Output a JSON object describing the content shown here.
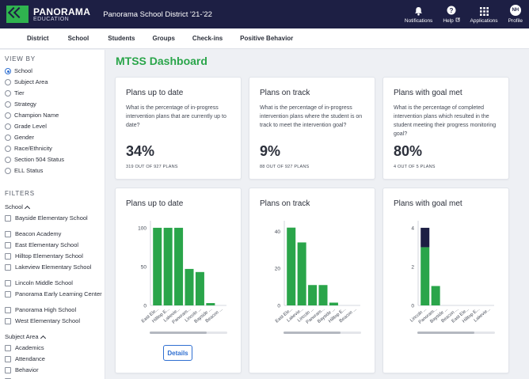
{
  "header": {
    "logo_line1": "PANORAMA",
    "logo_line2": "EDUCATION",
    "district": "Panorama School District '21-'22",
    "actions": {
      "notifications": "Notifications",
      "help": "Help",
      "applications": "Applications",
      "profile": "Profile"
    },
    "avatar_initials": "NH"
  },
  "nav": {
    "tabs": [
      "District",
      "School",
      "Students",
      "Groups",
      "Check-ins",
      "Positive Behavior"
    ]
  },
  "sidebar": {
    "view_by_title": "VIEW BY",
    "view_by": [
      "School",
      "Subject Area",
      "Tier",
      "Strategy",
      "Champion Name",
      "Grade Level",
      "Gender",
      "Race/Ethnicity",
      "Section 504 Status",
      "ELL Status"
    ],
    "view_by_selected": 0,
    "filters_title": "FILTERS",
    "school_filter_title": "School",
    "schools": [
      "Bayside Elementary School",
      "Beacon Academy",
      "East Elementary School",
      "Hilltop Elementary School",
      "Lakeview Elementary School",
      "Lincoln Middle School",
      "Panorama Early Learning Center",
      "Panorama High School",
      "West Elementary School"
    ],
    "subject_filter_title": "Subject Area",
    "subjects": [
      "Academics",
      "Attendance",
      "Behavior"
    ]
  },
  "main": {
    "title": "MTSS Dashboard",
    "stat_cards": [
      {
        "title": "Plans up to date",
        "description": "What is the percentage of in-progress intervention plans that are currently up to date?",
        "value": "34%",
        "sub": "319 OUT OF 927 PLANS"
      },
      {
        "title": "Plans on track",
        "description": "What is the percentage of in-progress intervention plans where the student is on track to meet the intervention goal?",
        "value": "9%",
        "sub": "88 OUT OF 927 PLANS"
      },
      {
        "title": "Plans with goal met",
        "description": "What is the percentage of completed intervention plans which resulted in the student meeting their progress monitoring goal?",
        "value": "80%",
        "sub": "4 OUT OF 5 PLANS"
      }
    ],
    "details_label": "Details"
  },
  "chart_data": [
    {
      "type": "bar",
      "title": "Plans up to date",
      "categories": [
        "East Ele...",
        "Hilltop E...",
        "Lakevie...",
        "Panoram...",
        "Lincoln ...",
        "Bayside ...",
        "Beacon ..."
      ],
      "values": [
        100,
        100,
        100,
        47,
        43,
        3,
        0
      ],
      "yticks": [
        0,
        50,
        100
      ],
      "ylim": [
        0,
        105
      ]
    },
    {
      "type": "bar",
      "title": "Plans on track",
      "categories": [
        "East Ele...",
        "Lakevie...",
        "Lincoln ...",
        "Panoram...",
        "Bayside ...",
        "Hilltop E...",
        "Beacon ..."
      ],
      "values": [
        42,
        34,
        11,
        11,
        1.5,
        0,
        0
      ],
      "yticks": [
        0,
        20,
        40
      ],
      "ylim": [
        0,
        44
      ]
    },
    {
      "type": "bar",
      "stacked": true,
      "title": "Plans with goal met",
      "categories": [
        "Lincoln ...",
        "Panoram...",
        "Bayside ...",
        "Beacon ...",
        "East Ele...",
        "Hilltop E...",
        "Lakevie..."
      ],
      "series": [
        {
          "values": [
            3,
            1,
            0,
            0,
            0,
            0,
            0
          ],
          "color": "#2aa54a"
        },
        {
          "values": [
            1,
            0,
            0,
            0,
            0,
            0,
            0
          ],
          "color": "#1d1f44"
        }
      ],
      "yticks": [
        0,
        2,
        4
      ],
      "ylim": [
        0,
        4.2
      ]
    }
  ],
  "colors": {
    "accent_green": "#2aa54a",
    "navy": "#1d1f44",
    "link_blue": "#2f6fd1"
  }
}
